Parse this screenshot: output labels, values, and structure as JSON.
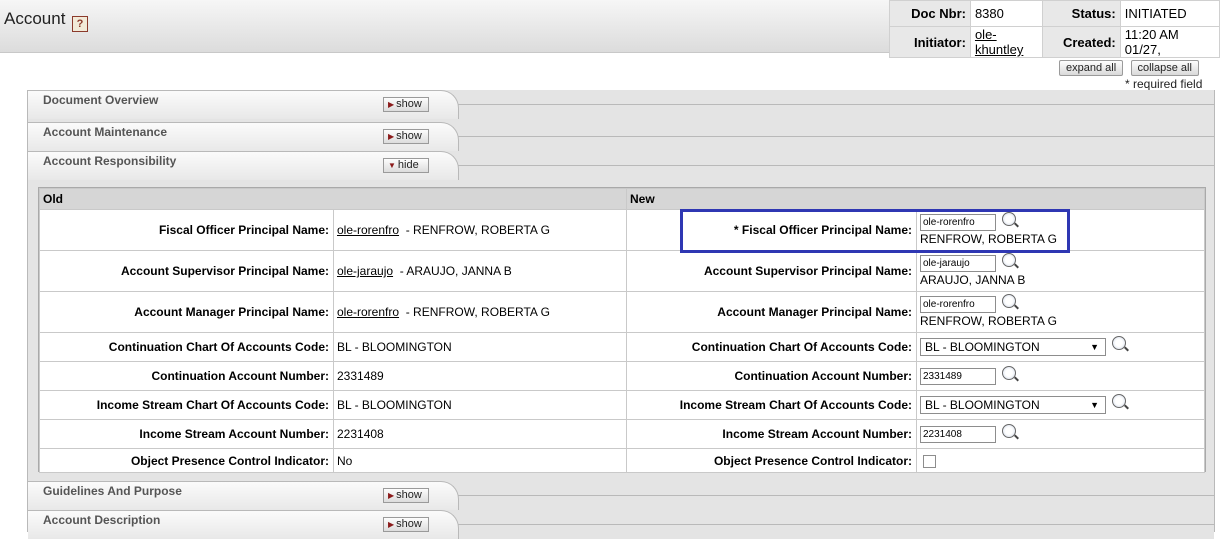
{
  "header": {
    "title": "Account",
    "help_icon": "?",
    "doc_nbr_label": "Doc Nbr:",
    "doc_nbr": "8380",
    "status_label": "Status:",
    "status": "INITIATED",
    "initiator_label": "Initiator:",
    "initiator": "ole-khuntley",
    "created_label": "Created:",
    "created": "11:20 AM 01/27,"
  },
  "buttons": {
    "expand_all": "expand all",
    "collapse_all": "collapse all"
  },
  "required_note": "* required field",
  "tabs": [
    {
      "title": "Document Overview",
      "button": "show"
    },
    {
      "title": "Account Maintenance",
      "button": "show"
    },
    {
      "title": "Account Responsibility",
      "button": "hide"
    },
    {
      "title": "Guidelines And Purpose",
      "button": "show"
    },
    {
      "title": "Account Description",
      "button": "show"
    }
  ],
  "responsibility": {
    "old_header": "Old",
    "new_header": "New",
    "rows": [
      {
        "label": "Fiscal Officer Principal Name:",
        "old_link": "ole-rorenfro",
        "old_name": "- RENFROW, ROBERTA G",
        "new_label": "*  Fiscal Officer Principal Name:",
        "new_input": "ole-rorenfro",
        "new_name": "RENFROW, ROBERTA G"
      },
      {
        "label": "Account Supervisor Principal Name:",
        "old_link": "ole-jaraujo",
        "old_name": "- ARAUJO, JANNA B",
        "new_label": "Account Supervisor Principal Name:",
        "new_input": "ole-jaraujo",
        "new_name": "ARAUJO, JANNA B"
      },
      {
        "label": "Account Manager Principal Name:",
        "old_link": "ole-rorenfro",
        "old_name": "- RENFROW, ROBERTA G",
        "new_label": "Account Manager Principal Name:",
        "new_input": "ole-rorenfro",
        "new_name": "RENFROW, ROBERTA G"
      },
      {
        "label": "Continuation Chart Of Accounts Code:",
        "old_value": "BL - BLOOMINGTON",
        "new_label": "Continuation Chart Of Accounts Code:",
        "new_select": "BL  -  BLOOMINGTON"
      },
      {
        "label": "Continuation Account Number:",
        "old_value": "2331489",
        "new_label": "Continuation Account Number:",
        "new_input": "2331489"
      },
      {
        "label": "Income Stream Chart Of Accounts Code:",
        "old_value": "BL - BLOOMINGTON",
        "new_label": "Income Stream Chart Of Accounts Code:",
        "new_select": "BL  -  BLOOMINGTON"
      },
      {
        "label": "Income Stream Account Number:",
        "old_value": "2231408",
        "new_label": "Income Stream Account Number:",
        "new_input": "2231408"
      },
      {
        "label": "Object Presence Control Indicator:",
        "old_value": "No",
        "new_label": "Object Presence Control Indicator:"
      }
    ]
  }
}
